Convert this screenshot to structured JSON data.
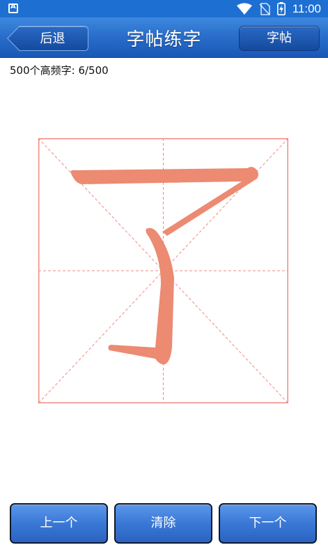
{
  "status_bar": {
    "time": "11:00",
    "icons": [
      "app-a-icon",
      "wifi-icon",
      "no-sim-icon",
      "battery-charging-icon"
    ],
    "color": "#1e6fd2"
  },
  "header": {
    "title": "字帖练字",
    "back_label": "后退",
    "copybook_label": "字帖",
    "color": "#2a6fcb"
  },
  "progress_text": "500个高频字: 6/500",
  "practice": {
    "character": "了",
    "stroke_color": "#ec8a72",
    "grid_color": "#f08a80"
  },
  "bottom_bar": {
    "prev_label": "上一个",
    "clear_label": "清除",
    "next_label": "下一个",
    "button_color": "#3a78d6"
  }
}
